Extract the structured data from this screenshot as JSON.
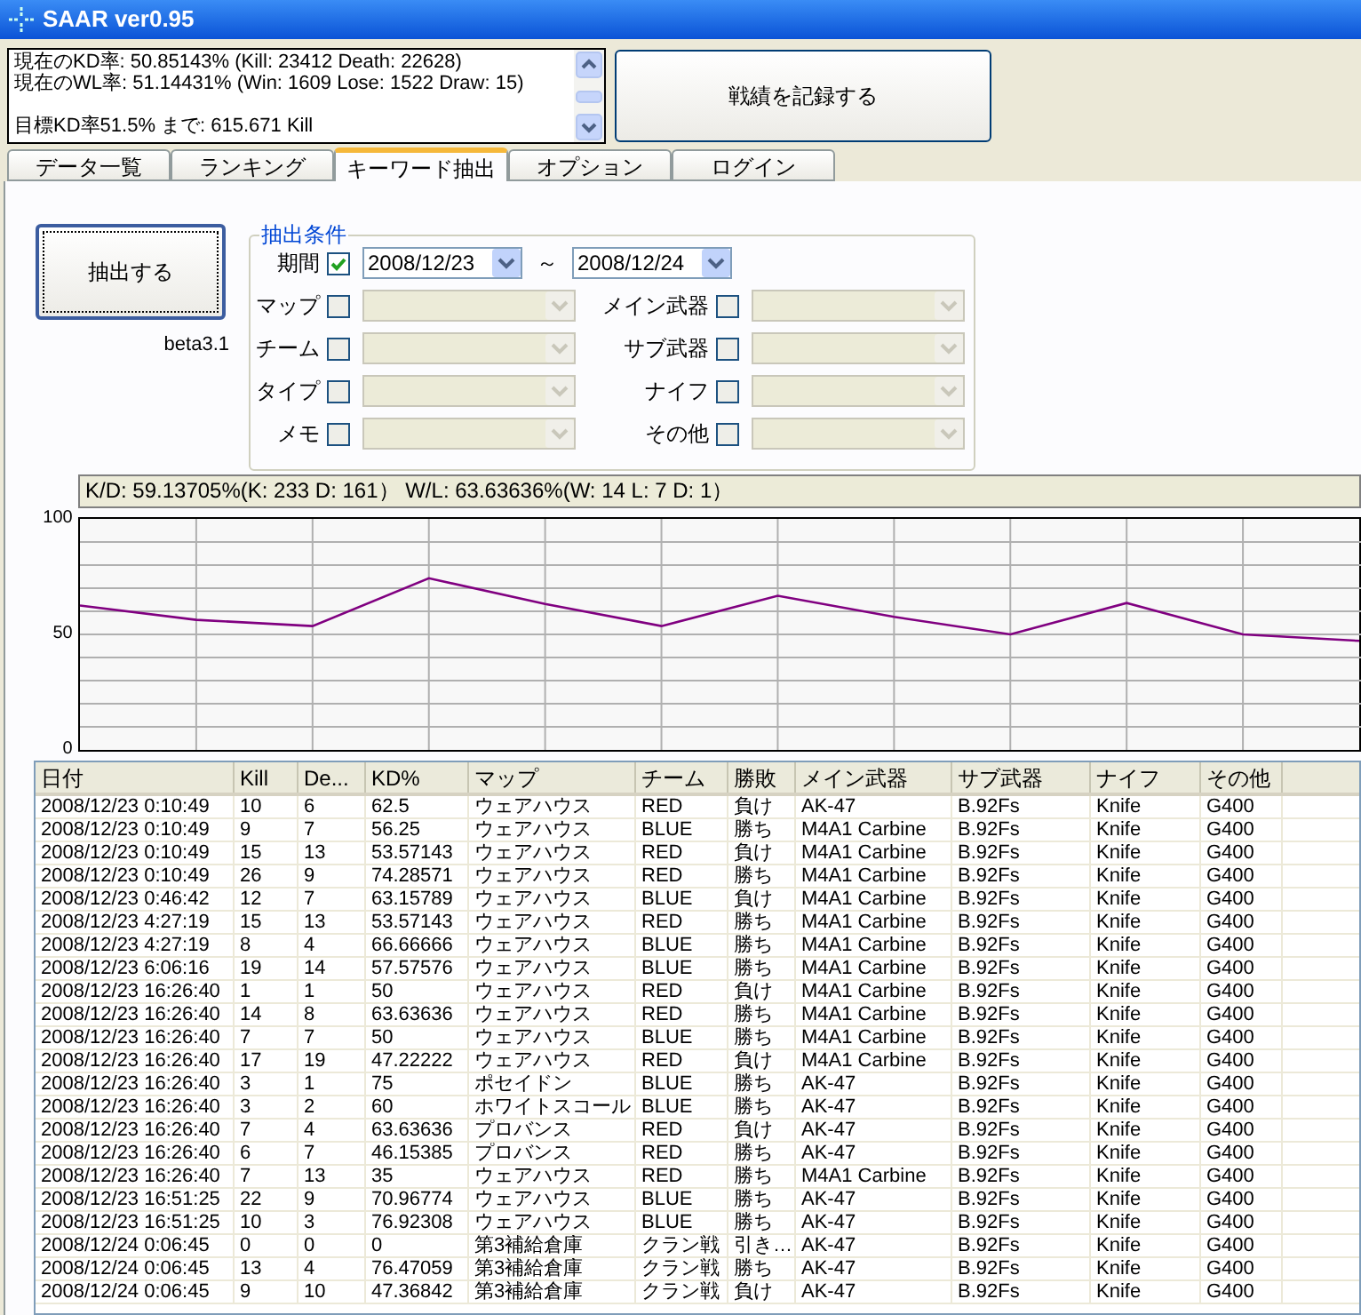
{
  "window": {
    "title": "SAAR ver0.95"
  },
  "summary": {
    "lines": [
      "現在のKD率: 50.85143% (Kill: 23412 Death: 22628)",
      "現在のWL率: 51.14431% (Win: 1609 Lose: 1522 Draw: 15)"
    ],
    "target": "目標KD率51.5% まで: 615.671 Kill"
  },
  "record_button": "戦績を記録する",
  "tabs": [
    {
      "label": "データ一覧",
      "selected": false
    },
    {
      "label": "ランキング",
      "selected": false
    },
    {
      "label": "キーワード抽出",
      "selected": true
    },
    {
      "label": "オプション",
      "selected": false
    },
    {
      "label": "ログイン",
      "selected": false
    }
  ],
  "extract_button": "抽出する",
  "version": "beta3.1",
  "conditions": {
    "title": "抽出条件",
    "period": {
      "label": "期間",
      "checked": true,
      "from": "2008/12/23",
      "separator": "～",
      "to": "2008/12/24"
    },
    "left": [
      {
        "label": "マップ",
        "checked": false
      },
      {
        "label": "チーム",
        "checked": false
      },
      {
        "label": "タイプ",
        "checked": false
      },
      {
        "label": "メモ",
        "checked": false
      }
    ],
    "right": [
      {
        "label": "メイン武器",
        "checked": false
      },
      {
        "label": "サブ武器",
        "checked": false
      },
      {
        "label": "ナイフ",
        "checked": false
      },
      {
        "label": "その他",
        "checked": false
      }
    ]
  },
  "stats": "K/D: 59.13705%(K: 233  D: 161） W/L: 63.63636%(W: 14  L: 7  D: 1）",
  "chart_data": {
    "type": "line",
    "grid": true,
    "ylim": [
      0,
      100
    ],
    "yticks": [
      0,
      50,
      100
    ],
    "series": [
      {
        "color": "#800080",
        "values": [
          62.5,
          56.3,
          53.6,
          74.3,
          63.2,
          53.6,
          66.7,
          57.6,
          50,
          63.6,
          50,
          47.2
        ]
      }
    ]
  },
  "table": {
    "columns": [
      "日付",
      "Kill",
      "De...",
      "KD%",
      "マップ",
      "チーム",
      "勝敗",
      "メイン武器",
      "サブ武器",
      "ナイフ",
      "その他"
    ],
    "rows": [
      [
        "2008/12/23 0:10:49",
        "10",
        "6",
        "62.5",
        "ウェアハウス",
        "RED",
        "負け",
        "AK-47",
        "B.92Fs",
        "Knife",
        "G400"
      ],
      [
        "2008/12/23 0:10:49",
        "9",
        "7",
        "56.25",
        "ウェアハウス",
        "BLUE",
        "勝ち",
        "M4A1 Carbine",
        "B.92Fs",
        "Knife",
        "G400"
      ],
      [
        "2008/12/23 0:10:49",
        "15",
        "13",
        "53.57143",
        "ウェアハウス",
        "RED",
        "負け",
        "M4A1 Carbine",
        "B.92Fs",
        "Knife",
        "G400"
      ],
      [
        "2008/12/23 0:10:49",
        "26",
        "9",
        "74.28571",
        "ウェアハウス",
        "RED",
        "勝ち",
        "M4A1 Carbine",
        "B.92Fs",
        "Knife",
        "G400"
      ],
      [
        "2008/12/23 0:46:42",
        "12",
        "7",
        "63.15789",
        "ウェアハウス",
        "BLUE",
        "負け",
        "M4A1 Carbine",
        "B.92Fs",
        "Knife",
        "G400"
      ],
      [
        "2008/12/23 4:27:19",
        "15",
        "13",
        "53.57143",
        "ウェアハウス",
        "RED",
        "勝ち",
        "M4A1 Carbine",
        "B.92Fs",
        "Knife",
        "G400"
      ],
      [
        "2008/12/23 4:27:19",
        "8",
        "4",
        "66.66666",
        "ウェアハウス",
        "BLUE",
        "勝ち",
        "M4A1 Carbine",
        "B.92Fs",
        "Knife",
        "G400"
      ],
      [
        "2008/12/23 6:06:16",
        "19",
        "14",
        "57.57576",
        "ウェアハウス",
        "BLUE",
        "勝ち",
        "M4A1 Carbine",
        "B.92Fs",
        "Knife",
        "G400"
      ],
      [
        "2008/12/23 16:26:40",
        "1",
        "1",
        "50",
        "ウェアハウス",
        "RED",
        "負け",
        "M4A1 Carbine",
        "B.92Fs",
        "Knife",
        "G400"
      ],
      [
        "2008/12/23 16:26:40",
        "14",
        "8",
        "63.63636",
        "ウェアハウス",
        "RED",
        "勝ち",
        "M4A1 Carbine",
        "B.92Fs",
        "Knife",
        "G400"
      ],
      [
        "2008/12/23 16:26:40",
        "7",
        "7",
        "50",
        "ウェアハウス",
        "BLUE",
        "勝ち",
        "M4A1 Carbine",
        "B.92Fs",
        "Knife",
        "G400"
      ],
      [
        "2008/12/23 16:26:40",
        "17",
        "19",
        "47.22222",
        "ウェアハウス",
        "RED",
        "負け",
        "M4A1 Carbine",
        "B.92Fs",
        "Knife",
        "G400"
      ],
      [
        "2008/12/23 16:26:40",
        "3",
        "1",
        "75",
        "ポセイドン",
        "BLUE",
        "勝ち",
        "AK-47",
        "B.92Fs",
        "Knife",
        "G400"
      ],
      [
        "2008/12/23 16:26:40",
        "3",
        "2",
        "60",
        "ホワイトスコール",
        "BLUE",
        "勝ち",
        "AK-47",
        "B.92Fs",
        "Knife",
        "G400"
      ],
      [
        "2008/12/23 16:26:40",
        "7",
        "4",
        "63.63636",
        "プロバンス",
        "RED",
        "負け",
        "AK-47",
        "B.92Fs",
        "Knife",
        "G400"
      ],
      [
        "2008/12/23 16:26:40",
        "6",
        "7",
        "46.15385",
        "プロバンス",
        "RED",
        "勝ち",
        "AK-47",
        "B.92Fs",
        "Knife",
        "G400"
      ],
      [
        "2008/12/23 16:26:40",
        "7",
        "13",
        "35",
        "ウェアハウス",
        "RED",
        "勝ち",
        "M4A1 Carbine",
        "B.92Fs",
        "Knife",
        "G400"
      ],
      [
        "2008/12/23 16:51:25",
        "22",
        "9",
        "70.96774",
        "ウェアハウス",
        "BLUE",
        "勝ち",
        "AK-47",
        "B.92Fs",
        "Knife",
        "G400"
      ],
      [
        "2008/12/23 16:51:25",
        "10",
        "3",
        "76.92308",
        "ウェアハウス",
        "BLUE",
        "勝ち",
        "AK-47",
        "B.92Fs",
        "Knife",
        "G400"
      ],
      [
        "2008/12/24 0:06:45",
        "0",
        "0",
        "0",
        "第3補給倉庫",
        "クラン戦",
        "引き…",
        "AK-47",
        "B.92Fs",
        "Knife",
        "G400"
      ],
      [
        "2008/12/24 0:06:45",
        "13",
        "4",
        "76.47059",
        "第3補給倉庫",
        "クラン戦",
        "勝ち",
        "AK-47",
        "B.92Fs",
        "Knife",
        "G400"
      ],
      [
        "2008/12/24 0:06:45",
        "9",
        "10",
        "47.36842",
        "第3補給倉庫",
        "クラン戦",
        "負け",
        "AK-47",
        "B.92Fs",
        "Knife",
        "G400"
      ]
    ]
  }
}
